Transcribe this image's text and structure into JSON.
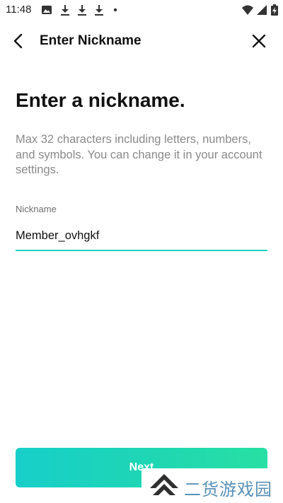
{
  "status_bar": {
    "time": "11:48",
    "left_icons": [
      "image-icon",
      "download-icon",
      "download-icon",
      "download-icon",
      "dot-icon"
    ],
    "right_icons": [
      "wifi-icon",
      "cellular-signal-icon",
      "battery-charging-icon"
    ]
  },
  "app_bar": {
    "title": "Enter Nickname",
    "back_icon": "chevron-left-icon",
    "close_icon": "close-icon"
  },
  "content": {
    "headline": "Enter a nickname.",
    "description": "Max 32 characters including letters, numbers, and symbols. You can change it in your account settings.",
    "field": {
      "label": "Nickname",
      "value": "Member_ovhgkf"
    }
  },
  "footer": {
    "next_label": "Next"
  },
  "watermark": {
    "text": "二货游戏园"
  },
  "colors": {
    "accent": "#1fd1c0",
    "gradient_start": "#17cfc9",
    "gradient_end": "#28e0a3",
    "description_text": "#8a8a8a",
    "watermark_text": "#5a91b8"
  }
}
